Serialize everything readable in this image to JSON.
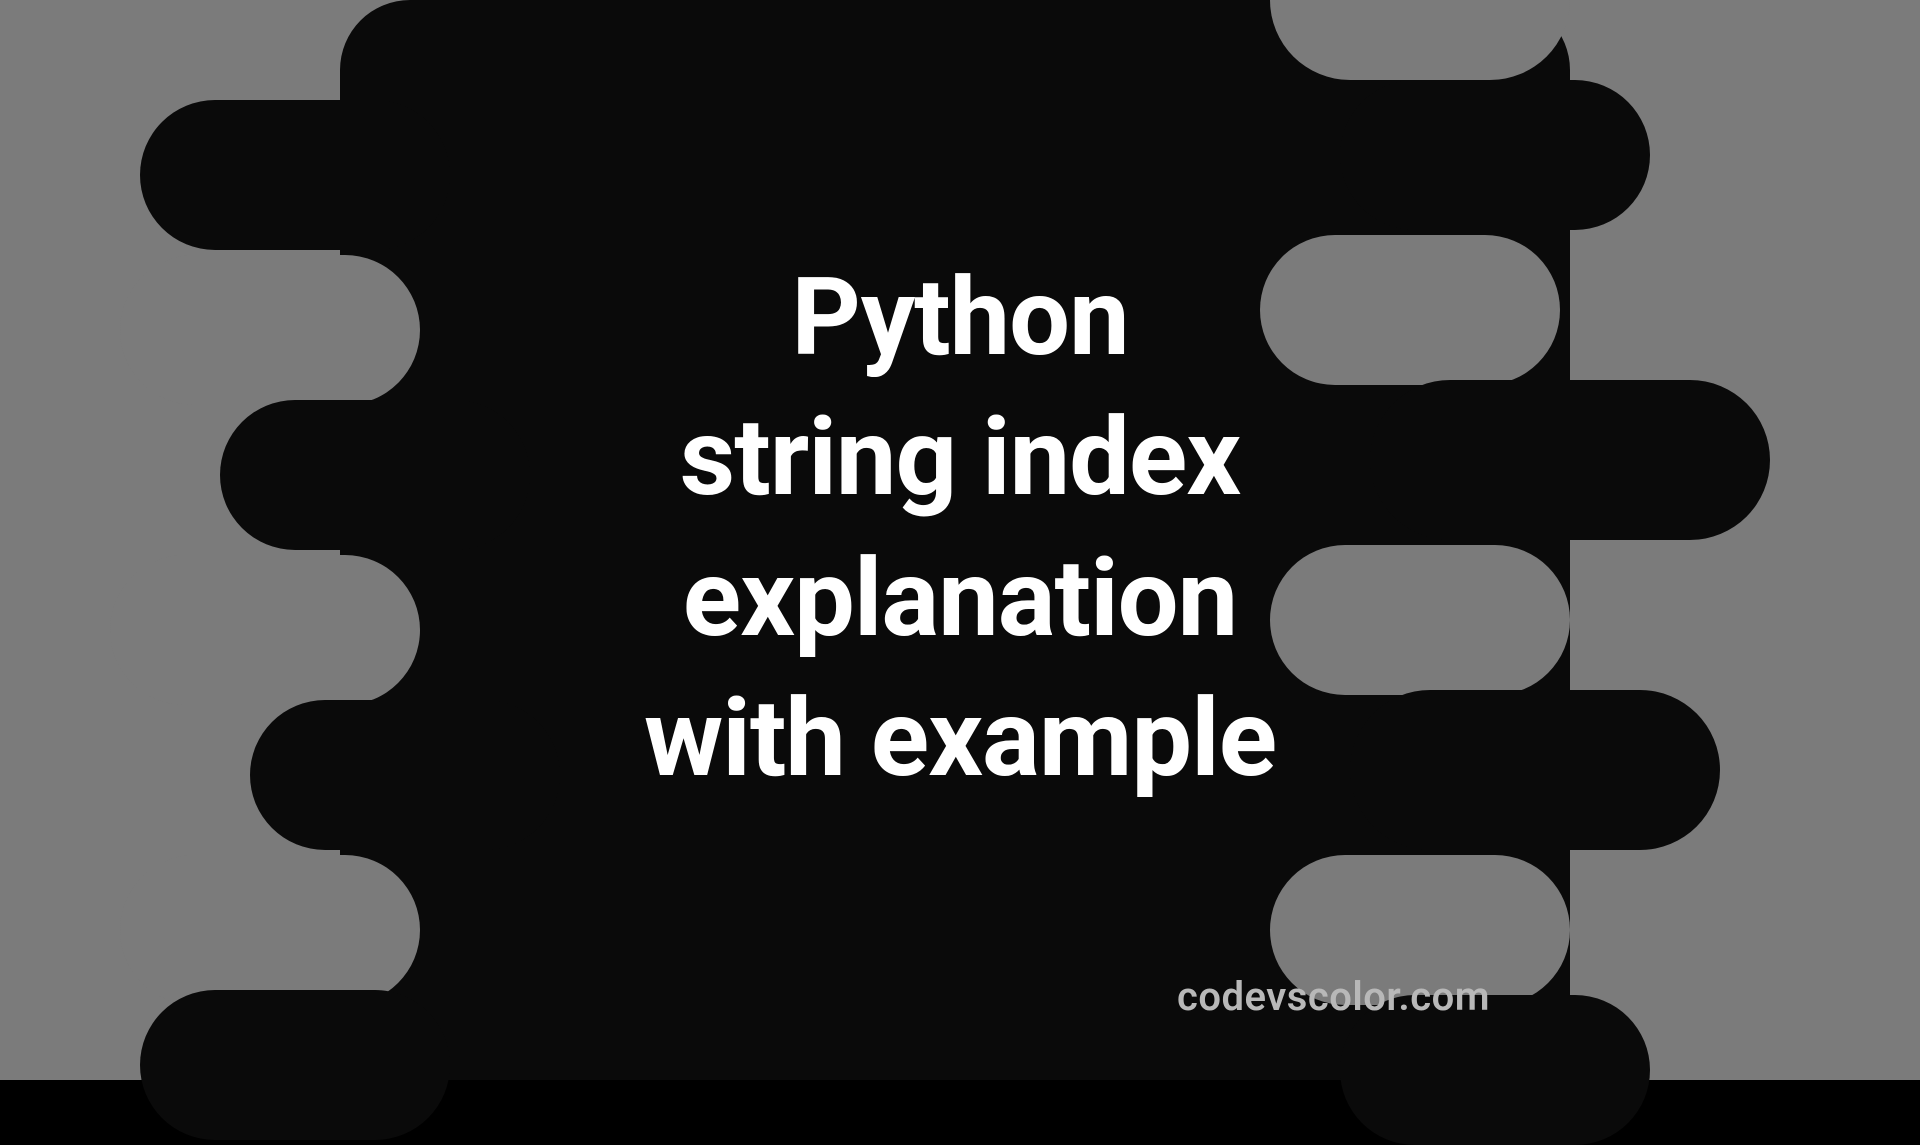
{
  "title": "Python\nstring index\nexplanation\nwith example",
  "watermark": "codevscolor.com",
  "colors": {
    "background": "#7b7b7b",
    "blob": "#0a0a0a",
    "text": "#ffffff",
    "watermark": "#b8b8b8"
  }
}
